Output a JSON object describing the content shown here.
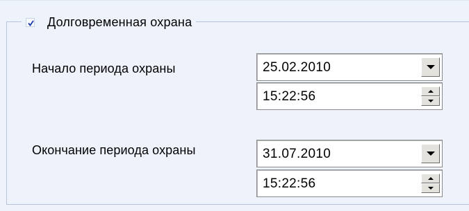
{
  "group": {
    "title": "Долговременная охрана",
    "checked": true
  },
  "start": {
    "label": "Начало периода охраны",
    "date": "25.02.2010",
    "time": "15:22:56"
  },
  "end": {
    "label": "Окончание периода охраны",
    "date": "31.07.2010",
    "time": "15:22:56"
  },
  "icons": {
    "check": "check-icon",
    "dropdown": "dropdown-arrow-icon",
    "spin_up": "spin-up-icon",
    "spin_down": "spin-down-icon"
  },
  "colors": {
    "panel_bg": "#eef3fb",
    "group_border": "#b7c3d6",
    "check_color": "#1c3aa8"
  }
}
